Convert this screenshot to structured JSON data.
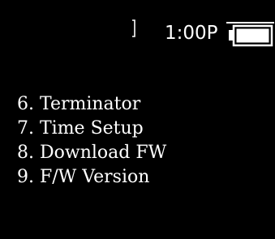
{
  "status_bar": {
    "time": "1:00P",
    "battery_icon": "battery-full-icon",
    "signal_icon": "signal-bracket-icon"
  },
  "menu": {
    "items": [
      {
        "label": "6. Terminator"
      },
      {
        "label": "7. Time Setup"
      },
      {
        "label": "8. Download FW"
      },
      {
        "label": "9. F/W Version"
      }
    ]
  },
  "colors": {
    "background": "#000000",
    "foreground": "#ffffff"
  }
}
